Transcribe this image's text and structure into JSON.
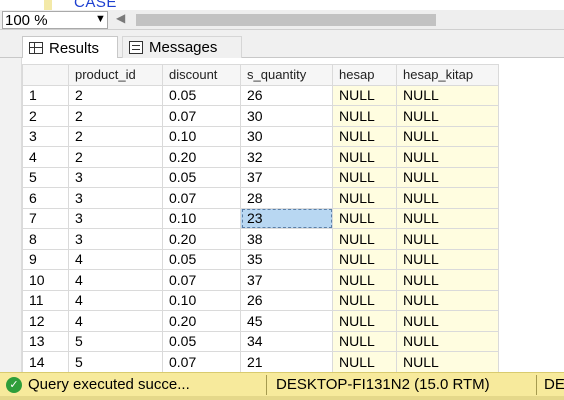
{
  "editor": {
    "code_fragment": "CASE"
  },
  "zoom": {
    "value": "100 %"
  },
  "tabs": [
    {
      "label": "Results",
      "icon": "grid-icon",
      "active": true
    },
    {
      "label": "Messages",
      "icon": "messages-icon",
      "active": false
    }
  ],
  "grid": {
    "columns": [
      "product_id",
      "discount",
      "s_quantity",
      "hesap",
      "hesap_kitap"
    ],
    "rows": [
      [
        "1",
        "2",
        "0.05",
        "26",
        "NULL",
        "NULL"
      ],
      [
        "2",
        "2",
        "0.07",
        "30",
        "NULL",
        "NULL"
      ],
      [
        "3",
        "2",
        "0.10",
        "30",
        "NULL",
        "NULL"
      ],
      [
        "4",
        "2",
        "0.20",
        "32",
        "NULL",
        "NULL"
      ],
      [
        "5",
        "3",
        "0.05",
        "37",
        "NULL",
        "NULL"
      ],
      [
        "6",
        "3",
        "0.07",
        "28",
        "NULL",
        "NULL"
      ],
      [
        "7",
        "3",
        "0.10",
        "23",
        "NULL",
        "NULL"
      ],
      [
        "8",
        "3",
        "0.20",
        "38",
        "NULL",
        "NULL"
      ],
      [
        "9",
        "4",
        "0.05",
        "35",
        "NULL",
        "NULL"
      ],
      [
        "10",
        "4",
        "0.07",
        "37",
        "NULL",
        "NULL"
      ],
      [
        "11",
        "4",
        "0.10",
        "26",
        "NULL",
        "NULL"
      ],
      [
        "12",
        "4",
        "0.20",
        "45",
        "NULL",
        "NULL"
      ],
      [
        "13",
        "5",
        "0.05",
        "34",
        "NULL",
        "NULL"
      ],
      [
        "14",
        "5",
        "0.07",
        "21",
        "NULL",
        "NULL"
      ]
    ],
    "selected_cell": {
      "row": 6,
      "col": 3
    }
  },
  "status": {
    "message": "Query executed succe...",
    "server": "DESKTOP-FI131N2 (15.0 RTM)",
    "database": "DE",
    "color": "#f7ea9c"
  }
}
